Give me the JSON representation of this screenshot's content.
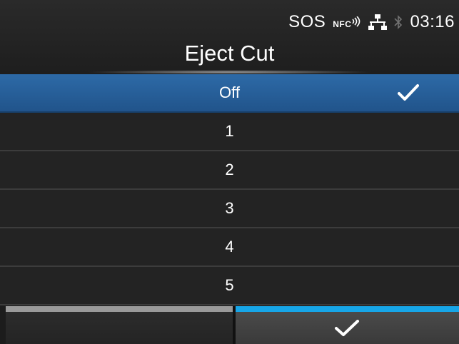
{
  "status": {
    "sos": "SOS",
    "nfc_label": "NFC",
    "time": "03:16"
  },
  "title": "Eject Cut",
  "options": [
    {
      "label": "Off",
      "selected": true
    },
    {
      "label": "1",
      "selected": false
    },
    {
      "label": "2",
      "selected": false
    },
    {
      "label": "3",
      "selected": false
    },
    {
      "label": "4",
      "selected": false
    },
    {
      "label": "5",
      "selected": false
    }
  ],
  "footer": {
    "left_button": "",
    "right_button_icon": "check-icon"
  },
  "colors": {
    "selected_row": "#2d6aa7",
    "confirm_accent": "#17a6e8",
    "back_accent": "#9a9a9a"
  }
}
